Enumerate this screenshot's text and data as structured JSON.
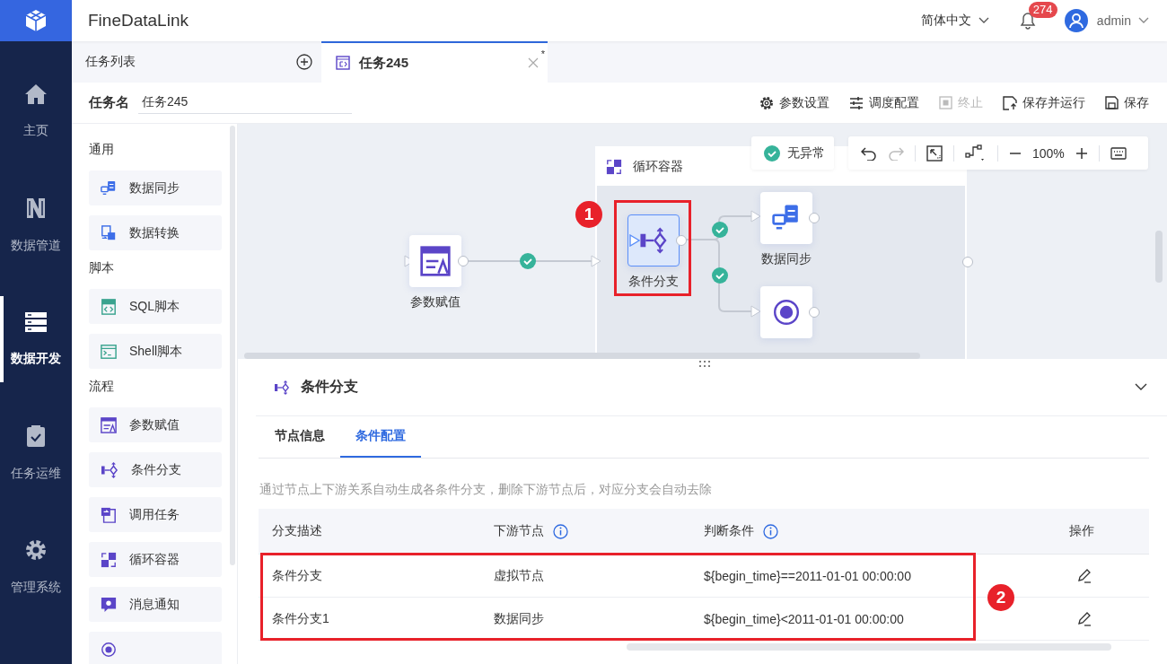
{
  "app": {
    "name": "FineDataLink"
  },
  "header": {
    "language": "简体中文",
    "notifications": "274",
    "user": "admin"
  },
  "nav": [
    {
      "label": "主页",
      "kind": "home",
      "selected": false
    },
    {
      "label": "数据管道",
      "kind": "pipe",
      "selected": false
    },
    {
      "label": "数据开发",
      "kind": "dev",
      "selected": true
    },
    {
      "label": "任务运维",
      "kind": "ops",
      "selected": false
    },
    {
      "label": "管理系统",
      "kind": "gear",
      "selected": false
    }
  ],
  "tabs": [
    {
      "label": "任务列表",
      "kind": "list",
      "selected": false
    },
    {
      "label": "任务245",
      "kind": "task",
      "selected": true,
      "unsaved_mark": "*"
    }
  ],
  "task_name": {
    "label": "任务名",
    "value": "任务245"
  },
  "toolbar": [
    {
      "label": "参数设置",
      "kind": "gear",
      "disabled": false
    },
    {
      "label": "调度配置",
      "kind": "sliders",
      "disabled": false
    },
    {
      "label": "终止",
      "kind": "stop",
      "disabled": true
    },
    {
      "label": "保存并运行",
      "kind": "saverun",
      "disabled": false
    },
    {
      "label": "保存",
      "kind": "save",
      "disabled": false
    }
  ],
  "palette": [
    {
      "title": "通用",
      "items": [
        {
          "label": "数据同步",
          "kind": "sync"
        },
        {
          "label": "数据转换",
          "kind": "transform"
        }
      ]
    },
    {
      "title": "脚本",
      "items": [
        {
          "label": "SQL脚本",
          "kind": "sql"
        },
        {
          "label": "Shell脚本",
          "kind": "shell"
        }
      ]
    },
    {
      "title": "流程",
      "items": [
        {
          "label": "参数赋值",
          "kind": "param"
        },
        {
          "label": "条件分支",
          "kind": "branch"
        },
        {
          "label": "调用任务",
          "kind": "call"
        },
        {
          "label": "循环容器",
          "kind": "loop"
        },
        {
          "label": "消息通知",
          "kind": "notify"
        },
        {
          "kind": "virtual"
        }
      ]
    }
  ],
  "canvas": {
    "status": "无异常",
    "zoom": "100%",
    "container": {
      "title": "循环容器"
    },
    "nodes": [
      {
        "label": "参数赋值",
        "kind": "param",
        "selected": false
      },
      {
        "label": "条件分支",
        "kind": "branch",
        "selected": true
      },
      {
        "label": "数据同步",
        "kind": "sync",
        "selected": false
      },
      {
        "kind": "virtual",
        "selected": false
      }
    ]
  },
  "annotations": [
    {
      "number": "1"
    },
    {
      "number": "2"
    }
  ],
  "panel": {
    "title": "条件分支",
    "tabs": [
      {
        "label": "节点信息",
        "selected": false
      },
      {
        "label": "条件配置",
        "selected": true
      }
    ],
    "hint": "通过节点上下游关系自动生成各条件分支，删除下游节点后，对应分支会自动去除",
    "columns": [
      {
        "label": "分支描述",
        "info": false
      },
      {
        "label": "下游节点",
        "info": true
      },
      {
        "label": "判断条件",
        "info": true
      },
      {
        "label": "操作",
        "info": false
      }
    ],
    "rows": [
      {
        "description": "条件分支",
        "downstream": "虚拟节点",
        "condition": "${begin_time}==2011-01-01 00:00:00"
      },
      {
        "description": "条件分支1",
        "downstream": "数据同步",
        "condition": "${begin_time}<2011-01-01 00:00:00"
      }
    ]
  }
}
